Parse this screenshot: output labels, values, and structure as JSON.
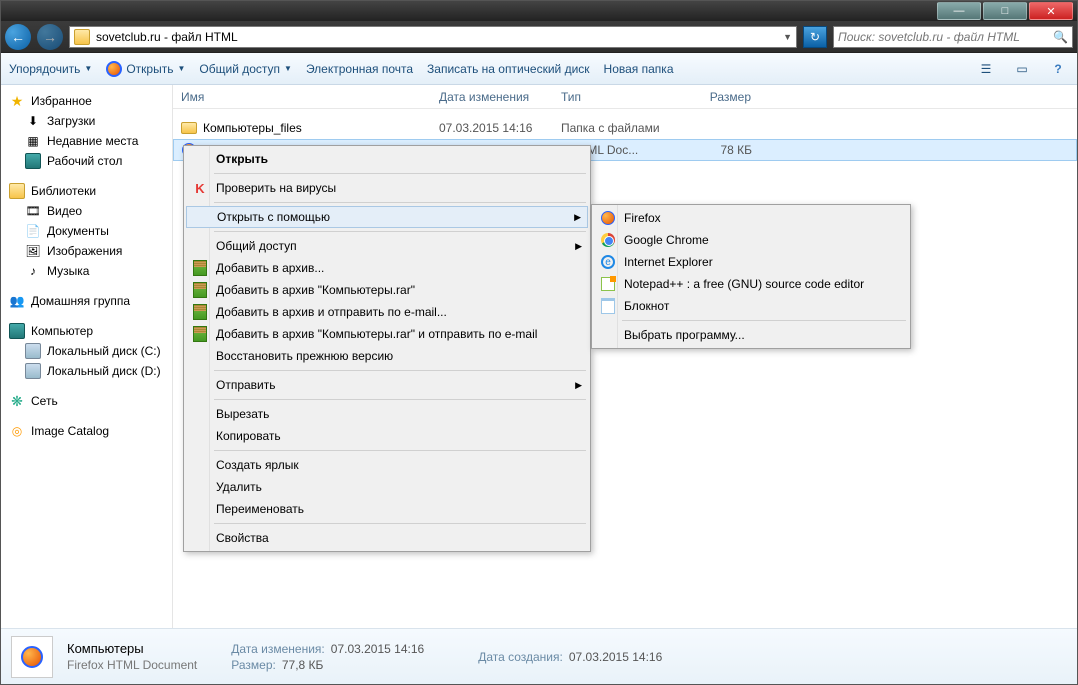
{
  "titlebar": {
    "min": "—",
    "max": "□",
    "close": "✕"
  },
  "nav": {
    "back": "←",
    "fwd": "→",
    "address": "sovetclub.ru - файл HTML",
    "refresh": "↻",
    "search_placeholder": "Поиск: sovetclub.ru - файл HTML",
    "search_icon": "🔍"
  },
  "toolbar": {
    "organize": "Упорядочить",
    "open": "Открыть",
    "share": "Общий доступ",
    "email": "Электронная почта",
    "burn": "Записать на оптический диск",
    "newfolder": "Новая папка",
    "views": "☰",
    "preview": "▭",
    "help": "?"
  },
  "navpane": {
    "favorites": "Избранное",
    "downloads": "Загрузки",
    "recent": "Недавние места",
    "desktop": "Рабочий стол",
    "libraries": "Библиотеки",
    "video": "Видео",
    "documents": "Документы",
    "pictures": "Изображения",
    "music": "Музыка",
    "homegroup": "Домашняя группа",
    "computer": "Компьютер",
    "drive_c": "Локальный диск (C:)",
    "drive_d": "Локальный диск (D:)",
    "network": "Сеть",
    "imagecatalog": "Image Catalog"
  },
  "columns": {
    "name": "Имя",
    "date": "Дата изменения",
    "type": "Тип",
    "size": "Размер"
  },
  "files": {
    "row0": {
      "name": "Компьютеры_files",
      "date": "07.03.2015 14:16",
      "type": "Папка с файлами",
      "size": ""
    },
    "row1": {
      "name": "",
      "date": "",
      "type": "x HTML Doc...",
      "size": "78 КБ"
    }
  },
  "ctx": {
    "open": "Открыть",
    "virus": "Проверить на вирусы",
    "openwith": "Открыть с помощью",
    "share": "Общий доступ",
    "addarchive": "Добавить в архив...",
    "addarchive_named": "Добавить в архив \"Компьютеры.rar\"",
    "addarchive_email": "Добавить в архив и отправить по e-mail...",
    "addarchive_named_email": "Добавить в архив \"Компьютеры.rar\" и отправить по e-mail",
    "restore": "Восстановить прежнюю версию",
    "sendto": "Отправить",
    "cut": "Вырезать",
    "copy": "Копировать",
    "shortcut": "Создать ярлык",
    "delete": "Удалить",
    "rename": "Переименовать",
    "properties": "Свойства"
  },
  "submenu": {
    "firefox": "Firefox",
    "chrome": "Google Chrome",
    "ie": "Internet Explorer",
    "npp": "Notepad++ : a free (GNU) source code editor",
    "notepad": "Блокнот",
    "choose": "Выбрать программу..."
  },
  "details": {
    "name": "Компьютеры",
    "type": "Firefox HTML Document",
    "date_mod_lbl": "Дата изменения:",
    "date_mod": "07.03.2015 14:16",
    "date_cre_lbl": "Дата создания:",
    "date_cre": "07.03.2015 14:16",
    "size_lbl": "Размер:",
    "size": "77,8 КБ"
  }
}
